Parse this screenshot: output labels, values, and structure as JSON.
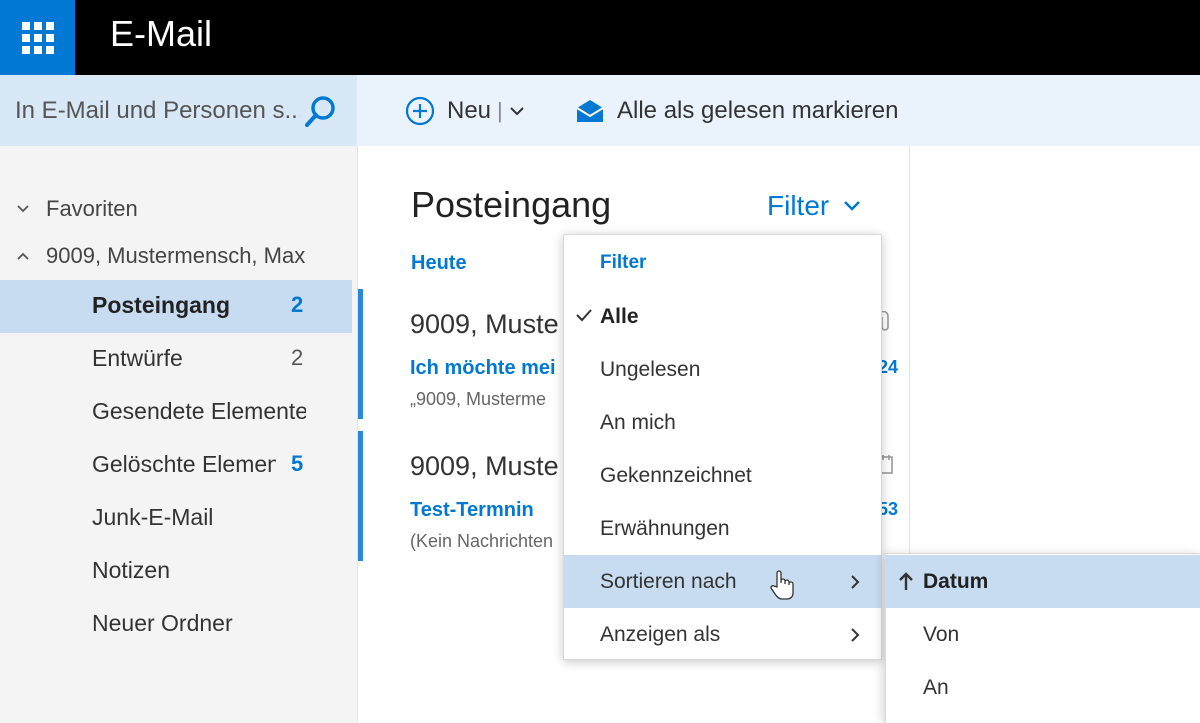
{
  "app": {
    "title": "E-Mail"
  },
  "search": {
    "placeholder": "In E-Mail und Personen s..."
  },
  "commands": {
    "new_label": "Neu",
    "separator": "|",
    "mark_all_read_label": "Alle als gelesen markieren"
  },
  "folders": {
    "favorites_label": "Favoriten",
    "account_label": "9009, Mustermensch, Max",
    "items": [
      {
        "name": "Posteingang",
        "count": "2",
        "selected": true
      },
      {
        "name": "Entwürfe",
        "count": "2"
      },
      {
        "name": "Gesendete Elemente",
        "count": ""
      },
      {
        "name": "Gelöschte Elemente",
        "count": "5"
      },
      {
        "name": "Junk-E-Mail",
        "count": ""
      },
      {
        "name": "Notizen",
        "count": ""
      },
      {
        "name": "Neuer Ordner",
        "count": ""
      }
    ]
  },
  "list": {
    "title": "Posteingang",
    "filter_label": "Filter",
    "group_label": "Heute",
    "messages": [
      {
        "sender": "9009, Muste",
        "subject": "Ich möchte mei",
        "preview": "„9009, Musterme",
        "time": "24"
      },
      {
        "sender": "9009, Muste",
        "subject": "Test-Termnin",
        "preview": "(Kein Nachrichten",
        "time": "53"
      }
    ]
  },
  "filter_menu": {
    "header": "Filter",
    "items": [
      {
        "label": "Alle",
        "checked": true
      },
      {
        "label": "Ungelesen"
      },
      {
        "label": "An mich"
      },
      {
        "label": "Gekennzeichnet"
      },
      {
        "label": "Erwähnungen"
      },
      {
        "label": "Sortieren nach",
        "submenu": true,
        "hover": true
      },
      {
        "label": "Anzeigen als",
        "submenu": true
      }
    ]
  },
  "sort_submenu": {
    "items": [
      {
        "label": "Datum",
        "active": true,
        "direction": "ascending"
      },
      {
        "label": "Von"
      },
      {
        "label": "An"
      }
    ]
  },
  "colors": {
    "accent": "#0078d4",
    "topbar": "#000000",
    "selection": "#c7dcf0",
    "commandbar": "#eaf3fb"
  }
}
